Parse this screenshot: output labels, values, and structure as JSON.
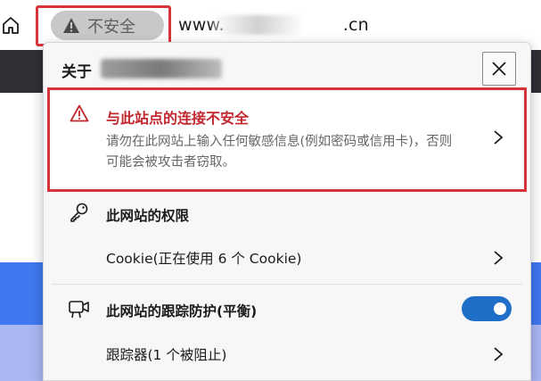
{
  "address_bar": {
    "security_chip_label": "不安全",
    "url_prefix": "www.",
    "url_suffix": ".cn"
  },
  "popup": {
    "title_prefix": "关于",
    "warning": {
      "title": "与此站点的连接不安全",
      "description": "请勿在此网站上输入任何敏感信息(例如密码或信用卡)，否则可能会被攻击者窃取。"
    },
    "permissions": {
      "heading": "此网站的权限",
      "cookie_row": "Cookie(正在使用 6 个 Cookie)"
    },
    "tracking": {
      "heading": "此网站的跟踪防护(平衡)",
      "toggle_on": true,
      "trackers_row": "跟踪器(1 个被阻止)"
    }
  },
  "colors": {
    "warning_red": "#c1272d",
    "toggle_blue": "#1f6fc9",
    "highlight_red": "#d9333a"
  },
  "icons": {
    "home": "home-icon",
    "security_chip": "warning-triangle-icon",
    "close": "close-icon",
    "warning": "warning-triangle-icon",
    "permissions": "key-icon",
    "tracking": "tracking-camera-icon",
    "chevron": "chevron-right-icon"
  }
}
